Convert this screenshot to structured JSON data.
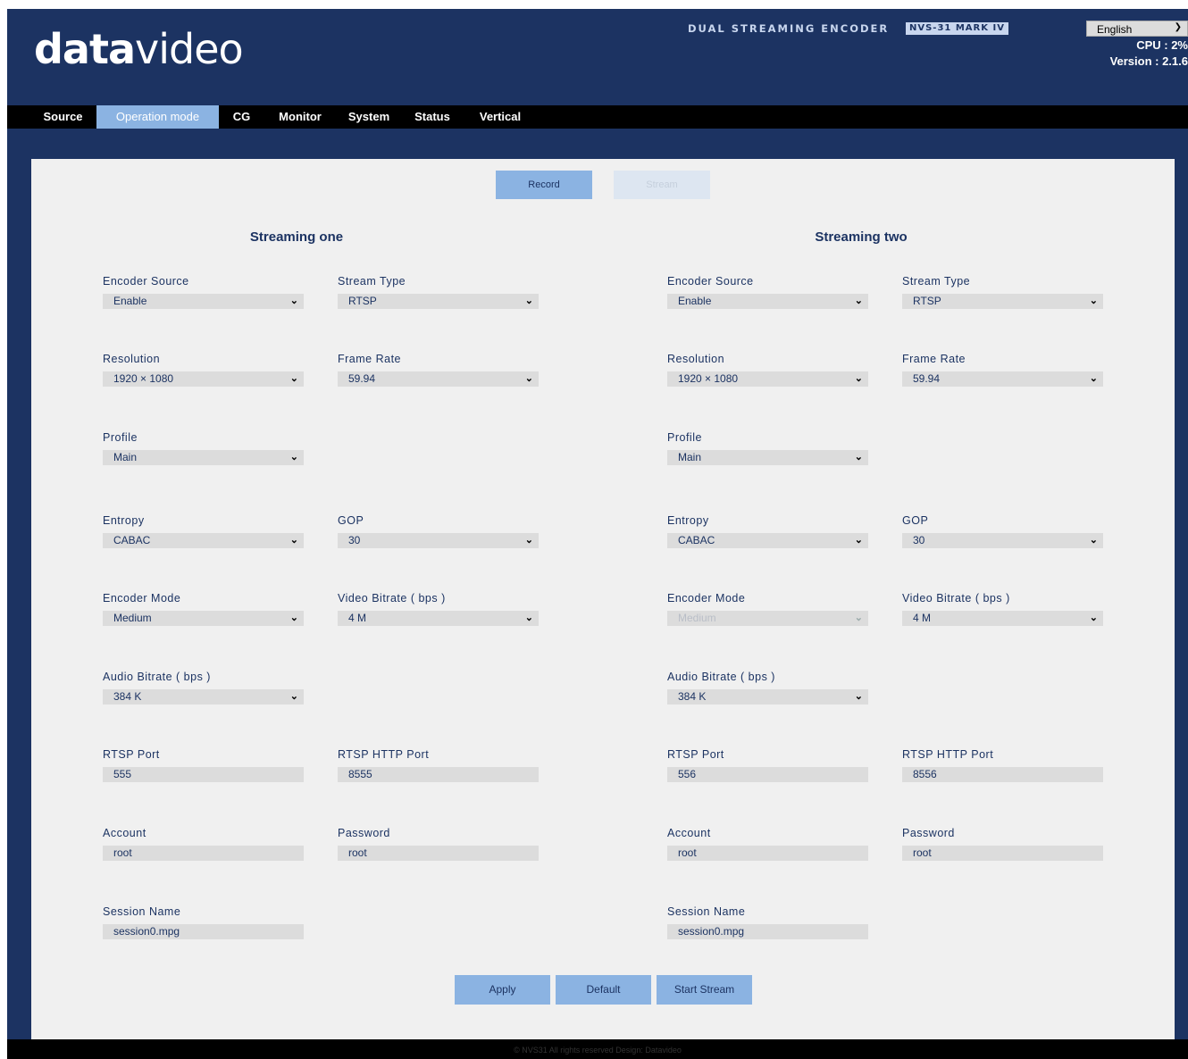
{
  "header": {
    "logo_bold": "data",
    "logo_thin": "video",
    "product_title": "DUAL STREAMING ENCODER",
    "model": "NVS-31 MARK IV",
    "language": "English",
    "cpu": "CPU  : 2%",
    "version": "Version : 2.1.6"
  },
  "nav": {
    "tabs": [
      "Source",
      "Operation mode",
      "CG",
      "Monitor",
      "System",
      "Status",
      "Vertical"
    ],
    "active": "Operation mode"
  },
  "mode": {
    "record": "Record",
    "stream": "Stream"
  },
  "columns": [
    {
      "title": "Streaming one",
      "labels": {
        "encoder_source": "Encoder Source",
        "stream_type": "Stream Type",
        "resolution": "Resolution",
        "frame_rate": "Frame Rate",
        "profile": "Profile",
        "entropy": "Entropy",
        "gop": "GOP",
        "encoder_mode": "Encoder Mode",
        "video_bitrate": "Video Bitrate ( bps )",
        "audio_bitrate": "Audio Bitrate ( bps )",
        "rtsp_port": "RTSP Port",
        "rtsp_http_port": "RTSP HTTP Port",
        "account": "Account",
        "password": "Password",
        "session_name": "Session Name"
      },
      "values": {
        "encoder_source": "Enable",
        "stream_type": "RTSP",
        "resolution": "1920 × 1080",
        "frame_rate": "59.94",
        "profile": "Main",
        "entropy": "CABAC",
        "gop": "30",
        "encoder_mode": "Medium",
        "video_bitrate": "4 M",
        "audio_bitrate": "384 K",
        "rtsp_port": "555",
        "rtsp_http_port": "8555",
        "account": "root",
        "password": "root",
        "session_name": "session0.mpg"
      }
    },
    {
      "title": "Streaming two",
      "labels": {
        "encoder_source": "Encoder Source",
        "stream_type": "Stream Type",
        "resolution": "Resolution",
        "frame_rate": "Frame Rate",
        "profile": "Profile",
        "entropy": "Entropy",
        "gop": "GOP",
        "encoder_mode": "Encoder Mode",
        "video_bitrate": "Video Bitrate ( bps )",
        "audio_bitrate": "Audio Bitrate ( bps )",
        "rtsp_port": "RTSP Port",
        "rtsp_http_port": "RTSP HTTP Port",
        "account": "Account",
        "password": "Password",
        "session_name": "Session Name"
      },
      "values": {
        "encoder_source": "Enable",
        "stream_type": "RTSP",
        "resolution": "1920 × 1080",
        "frame_rate": "59.94",
        "profile": "Main",
        "entropy": "CABAC",
        "gop": "30",
        "encoder_mode": "Medium",
        "video_bitrate": "4 M",
        "audio_bitrate": "384 K",
        "rtsp_port": "556",
        "rtsp_http_port": "8556",
        "account": "root",
        "password": "root",
        "session_name": "session0.mpg"
      }
    }
  ],
  "actions": {
    "apply": "Apply",
    "default": "Default",
    "start_stream": "Start Stream"
  },
  "footer": "© NVS31 All rights reserved Design: Datavideo",
  "icons": {
    "dropdown": "chevron-down-icon"
  },
  "colors": {
    "header_bg": "#1c3362",
    "accent": "#8bb3e2",
    "panel": "#f0f0f0",
    "field": "#dcdcdc"
  }
}
